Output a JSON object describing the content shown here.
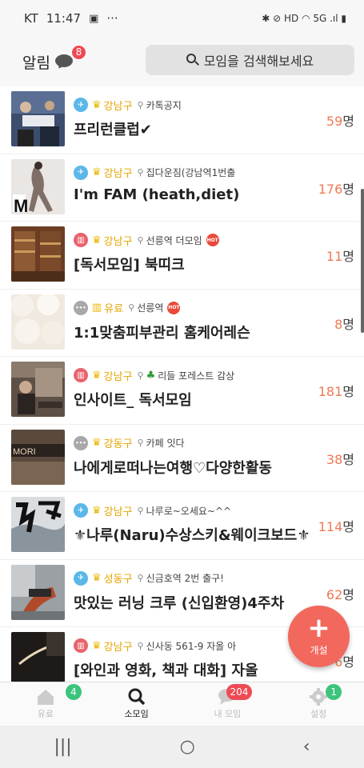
{
  "status_bar": {
    "carrier": "KT",
    "time": "11:47",
    "dots": "···",
    "right_text": "✱ ⊘ HD ◠ 5G .ıl ▮"
  },
  "header": {
    "alarm_label": "알림",
    "alarm_count": "8",
    "search_placeholder": "모임을 검색해보세요"
  },
  "meetups": [
    {
      "cat_color": "#5bb7e8",
      "cat_glyph": "✈",
      "region": "강남구",
      "location": "카톡공지",
      "hot": false,
      "title": "프리런클럽✔",
      "count": "59",
      "unit": "명"
    },
    {
      "cat_color": "#5bb7e8",
      "cat_glyph": "✈",
      "region": "강남구",
      "location": "집다운짐(강남역1번출",
      "hot": false,
      "title": "I'm FAM (heath,diet)",
      "count": "176",
      "unit": "명"
    },
    {
      "cat_color": "#e8646e",
      "cat_glyph": "▥",
      "region": "강남구",
      "location": "선릉역 더모임",
      "hot": true,
      "title": "[독서모임] 북띠크",
      "count": "11",
      "unit": "명"
    },
    {
      "cat_color": "#a8a8a8",
      "cat_glyph": "•••",
      "region": "유료",
      "location": "선릉역",
      "hot": true,
      "title": "1:1맞춤피부관리 홈케어레슨",
      "count": "8",
      "unit": "명"
    },
    {
      "cat_color": "#e8646e",
      "cat_glyph": "▥",
      "region": "강남구",
      "location": "리들 포레스트 감상",
      "hot": false,
      "tree": true,
      "title": "인사이트_ 독서모임",
      "count": "181",
      "unit": "명"
    },
    {
      "cat_color": "#a8a8a8",
      "cat_glyph": "•••",
      "region": "강동구",
      "location": "카페 잇다",
      "hot": false,
      "title": "나에게로떠나는여행♡다양한활동",
      "count": "38",
      "unit": "명"
    },
    {
      "cat_color": "#5bb7e8",
      "cat_glyph": "✈",
      "region": "강남구",
      "location": "나루로~오세요~^^",
      "hot": false,
      "title": "⚜나루(Naru)수상스키&웨이크보드⚜",
      "count": "114",
      "unit": "명"
    },
    {
      "cat_color": "#5bb7e8",
      "cat_glyph": "✈",
      "region": "성동구",
      "location": "신금호역 2번 출구!",
      "hot": false,
      "title": "맛있는 러닝 크루 (신입환영)4주차",
      "count": "62",
      "unit": "명"
    },
    {
      "cat_color": "#e8646e",
      "cat_glyph": "▥",
      "region": "강남구",
      "location": "신사동 561-9 자올 아",
      "hot": false,
      "title": "[와인과 영화, 책과 대화] 자올",
      "count": "6",
      "unit": "명"
    }
  ],
  "fab": {
    "plus": "+",
    "label": "개설"
  },
  "bottom_nav": [
    {
      "label": "유료",
      "badge": "4",
      "badge_color": "#3cc47c",
      "active": false
    },
    {
      "label": "소모임",
      "badge": "",
      "badge_color": "",
      "active": true
    },
    {
      "label": "내 모임",
      "badge": "204",
      "badge_color": "#ef4a54",
      "active": false
    },
    {
      "label": "설정",
      "badge": "1",
      "badge_color": "#3cc47c",
      "active": false
    }
  ],
  "system_nav": {
    "recent": "|||",
    "home": "○",
    "back": "‹"
  },
  "colors": {
    "accent": "#f2685d",
    "count_number": "#ef7a55",
    "region": "#e6a400"
  },
  "icons": {
    "search": "search-icon",
    "chat": "chat-bubble-icon",
    "location": "location-pin-icon"
  }
}
